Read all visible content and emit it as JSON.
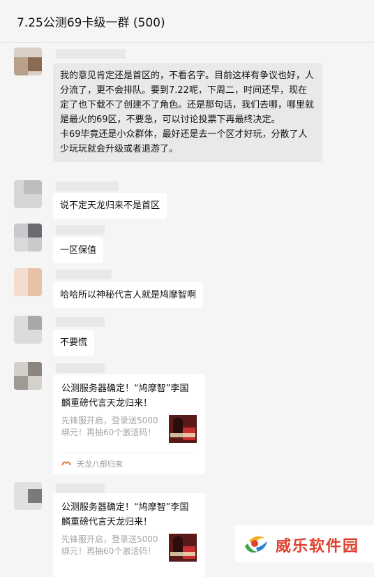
{
  "window": {
    "title": "7.25公测69卡级一群 (500)"
  },
  "messages": [
    {
      "type": "text",
      "text": "我的意见肯定还是首区的，不看名字。目前这样有争议也好，人分流了，更不会排队。要到7.22呢，下周二，时间还早，现在定了也下载不了创建不了角色。还是那句话，我们去哪，哪里就是最火的69区，不要急，可以讨论投票下再最终决定。",
      "text2": "卡69毕竟还是小众群体，最好还是去一个区才好玩，分散了人少玩玩就会升级或者退游了。"
    },
    {
      "type": "text",
      "text": "说不定天龙归来不是首区"
    },
    {
      "type": "text",
      "text": "一区保值"
    },
    {
      "type": "text",
      "text": "哈哈所以神秘代言人就是鸠摩智啊"
    },
    {
      "type": "text",
      "text": "不要慌"
    },
    {
      "type": "card",
      "title": "公测服务器确定！“鸠摩智”李国麟重磅代言天龙归来！",
      "desc": "先锋服开启，登录送5000绑元！再抽60个激活码！",
      "source": "天龙八部归来"
    },
    {
      "type": "card",
      "title": "公测服务器确定！“鸠摩智”李国麟重磅代言天龙归来！",
      "desc": "先锋服开启，登录送5000绑元！再抽60个激活码！"
    }
  ],
  "watermark": {
    "text": "威乐软件园"
  },
  "colors": {
    "accent": "#e0412c",
    "bubble_gray": "#e9e9e9",
    "background": "#f5f5f5"
  }
}
